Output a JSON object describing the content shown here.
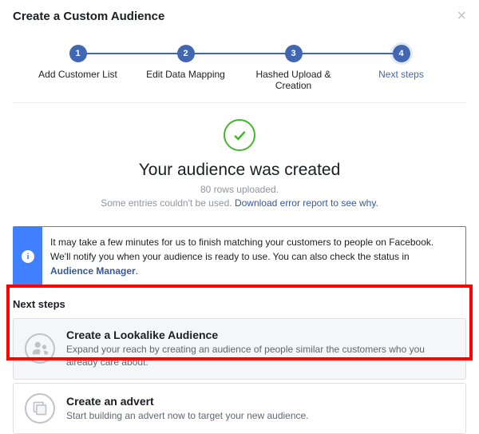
{
  "header": {
    "title": "Create a Custom Audience"
  },
  "stepper": {
    "s1": {
      "num": "1",
      "label": "Add Customer List"
    },
    "s2": {
      "num": "2",
      "label": "Edit Data Mapping"
    },
    "s3": {
      "num": "3",
      "label": "Hashed Upload & Creation"
    },
    "s4": {
      "num": "4",
      "label": "Next steps"
    }
  },
  "success": {
    "title": "Your audience was created",
    "rows": "80 rows uploaded.",
    "err_prefix": "Some entries couldn't be used. ",
    "err_link": "Download error report to see why."
  },
  "info": {
    "text_a": "It may take a few minutes for us to finish matching your customers to people on Facebook. We'll notify you when your audience is ready to use. You can also check the status in ",
    "text_b": "Audience Manager",
    "text_c": "."
  },
  "next": {
    "title": "Next steps",
    "opt1": {
      "title": "Create a Lookalike Audience",
      "desc": "Expand your reach by creating an audience of people similar the customers who you already care about."
    },
    "opt2": {
      "title": "Create an advert",
      "desc": "Start building an advert now to target your new audience."
    }
  }
}
